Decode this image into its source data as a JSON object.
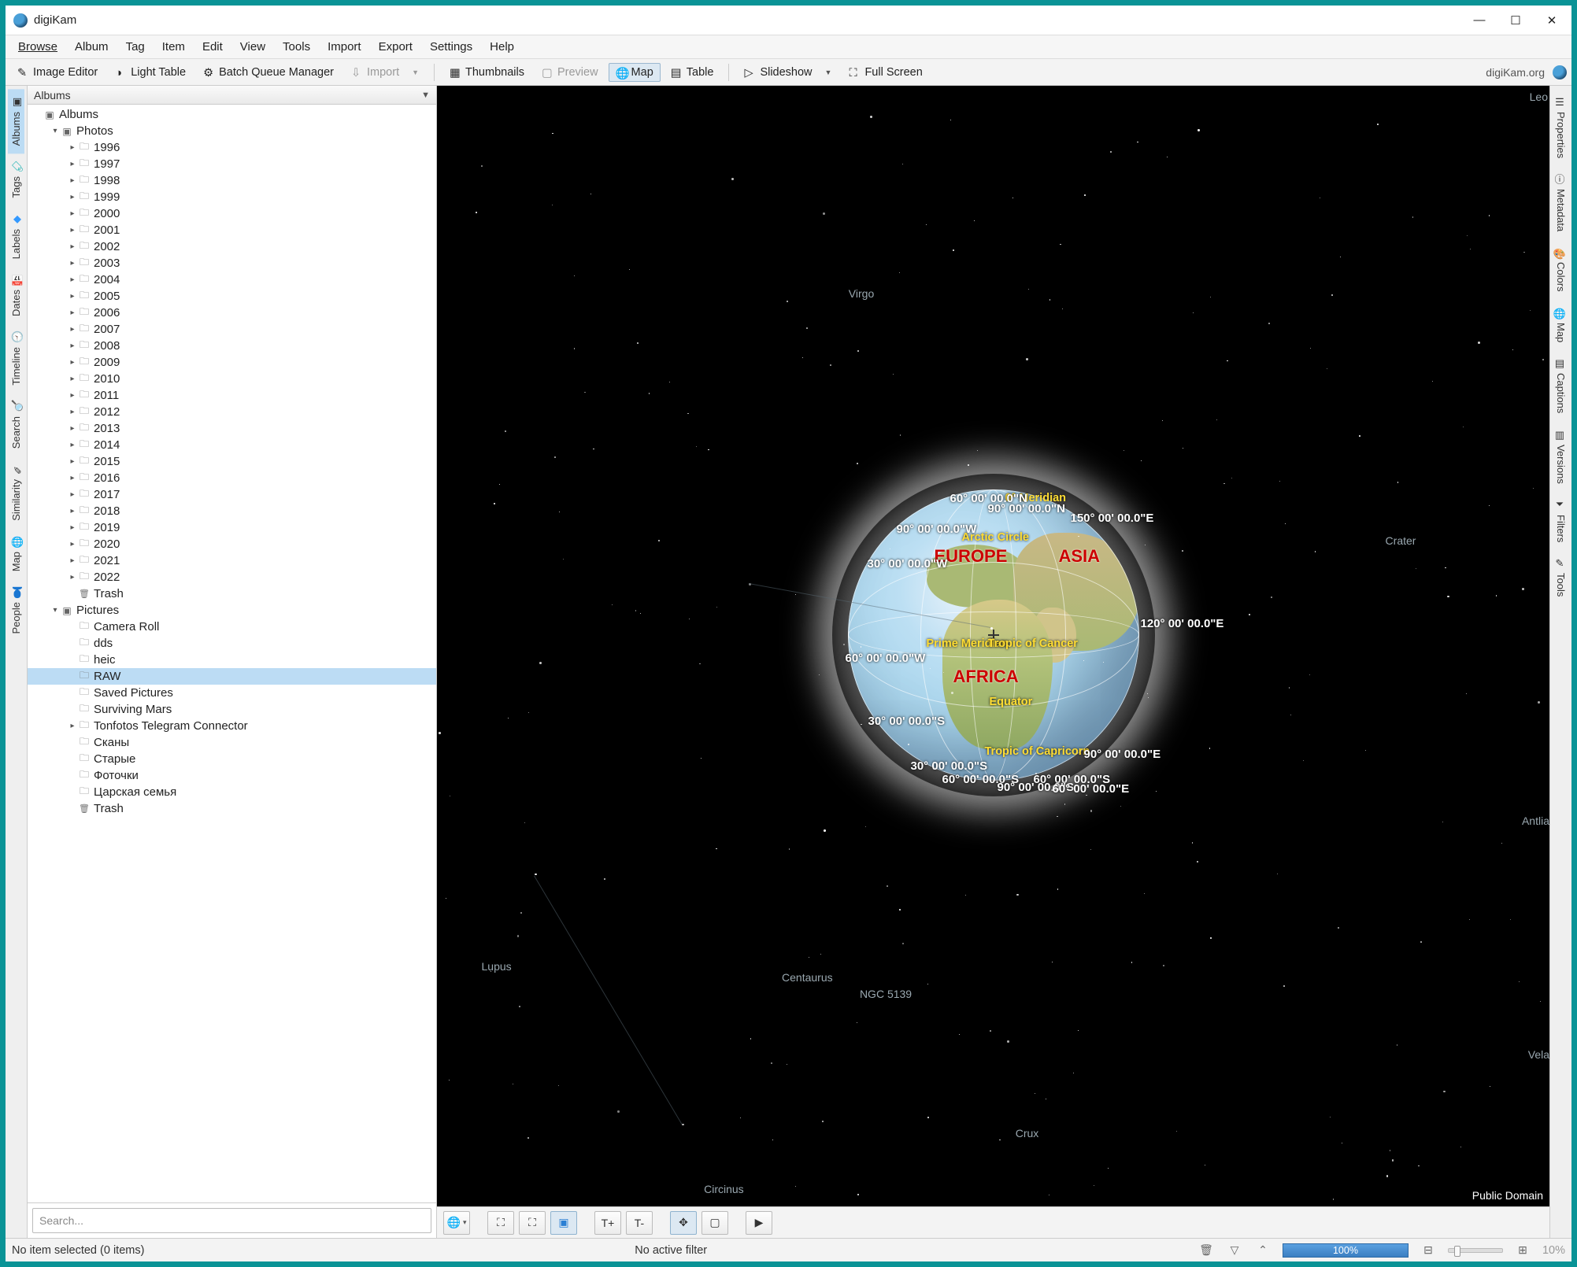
{
  "title": "digiKam",
  "menubar": [
    "Browse",
    "Album",
    "Tag",
    "Item",
    "Edit",
    "View",
    "Tools",
    "Import",
    "Export",
    "Settings",
    "Help"
  ],
  "toolbar": {
    "image_editor": "Image Editor",
    "light_table": "Light Table",
    "batch_queue": "Batch Queue Manager",
    "import": "Import",
    "thumbnails": "Thumbnails",
    "preview": "Preview",
    "map": "Map",
    "table": "Table",
    "slideshow": "Slideshow",
    "full_screen": "Full Screen",
    "brand": "digiKam.org"
  },
  "left_tabs": [
    "Albums",
    "Tags",
    "Labels",
    "Dates",
    "Timeline",
    "Search",
    "Similarity",
    "Map",
    "People"
  ],
  "right_tabs": [
    "Properties",
    "Metadata",
    "Colors",
    "Map",
    "Captions",
    "Versions",
    "Filters",
    "Tools"
  ],
  "sidebar": {
    "header": "Albums",
    "root": "Albums",
    "photos": "Photos",
    "years": [
      "1996",
      "1997",
      "1998",
      "1999",
      "2000",
      "2001",
      "2002",
      "2003",
      "2004",
      "2005",
      "2006",
      "2007",
      "2008",
      "2009",
      "2010",
      "2011",
      "2012",
      "2013",
      "2014",
      "2015",
      "2016",
      "2017",
      "2018",
      "2019",
      "2020",
      "2021",
      "2022"
    ],
    "trash": "Trash",
    "pictures": "Pictures",
    "pictures_children": [
      "Camera Roll",
      "dds",
      "heic",
      "RAW",
      "Saved Pictures",
      "Surviving Mars",
      "Tonfotos Telegram Connector",
      "Сканы",
      "Старые",
      "Фоточки",
      "Царская семья",
      "Trash"
    ],
    "selected": "RAW",
    "search_placeholder": "Search..."
  },
  "map": {
    "continents": {
      "europe": "EUROPE",
      "asia": "ASIA",
      "africa": "AFRICA"
    },
    "tropics": {
      "arctic": "Arctic Circle",
      "prime_top": "0° Meridian",
      "prime_mid": "Prime Meridian",
      "cancer": "Tropic of Cancer",
      "equator": "Equator",
      "capricorn": "Tropic of Capricorn"
    },
    "coords": {
      "n90": "90° 00' 00.0\"N",
      "n60": "60° 00' 00.0\"N",
      "w90": "90° 00' 00.0\"W",
      "w60": "60° 00' 00.0\"W",
      "w30": "30° 00' 00.0\"W",
      "s30a": "30° 00' 00.0\"S",
      "s30b": "30° 00' 00.0\"S",
      "s60a": "60° 00' 00.0\"S",
      "s60b": "60° 00' 00.0\"S",
      "s90": "90° 00' 00.0\"S",
      "e60": "60° 00' 00.0\"E",
      "e90": "90° 00' 00.0\"E",
      "e120": "120° 00' 00.0\"E",
      "e150": "150° 00' 00.0\"E"
    },
    "constellations": {
      "leo": "Leo",
      "virgo": "Virgo",
      "crater": "Crater",
      "antlia": "Antlia",
      "lupus": "Lupus",
      "centaurus": "Centaurus",
      "ngc": "NGC 5139",
      "circinus": "Circinus",
      "crux": "Crux",
      "vela": "Vela"
    },
    "attribution": "Public Domain"
  },
  "map_tools": {
    "text_plus": "T+",
    "text_minus": "T-"
  },
  "statusbar": {
    "selection": "No item selected (0 items)",
    "filter": "No active filter",
    "zoom_main": "100%",
    "zoom_side": "10%"
  }
}
